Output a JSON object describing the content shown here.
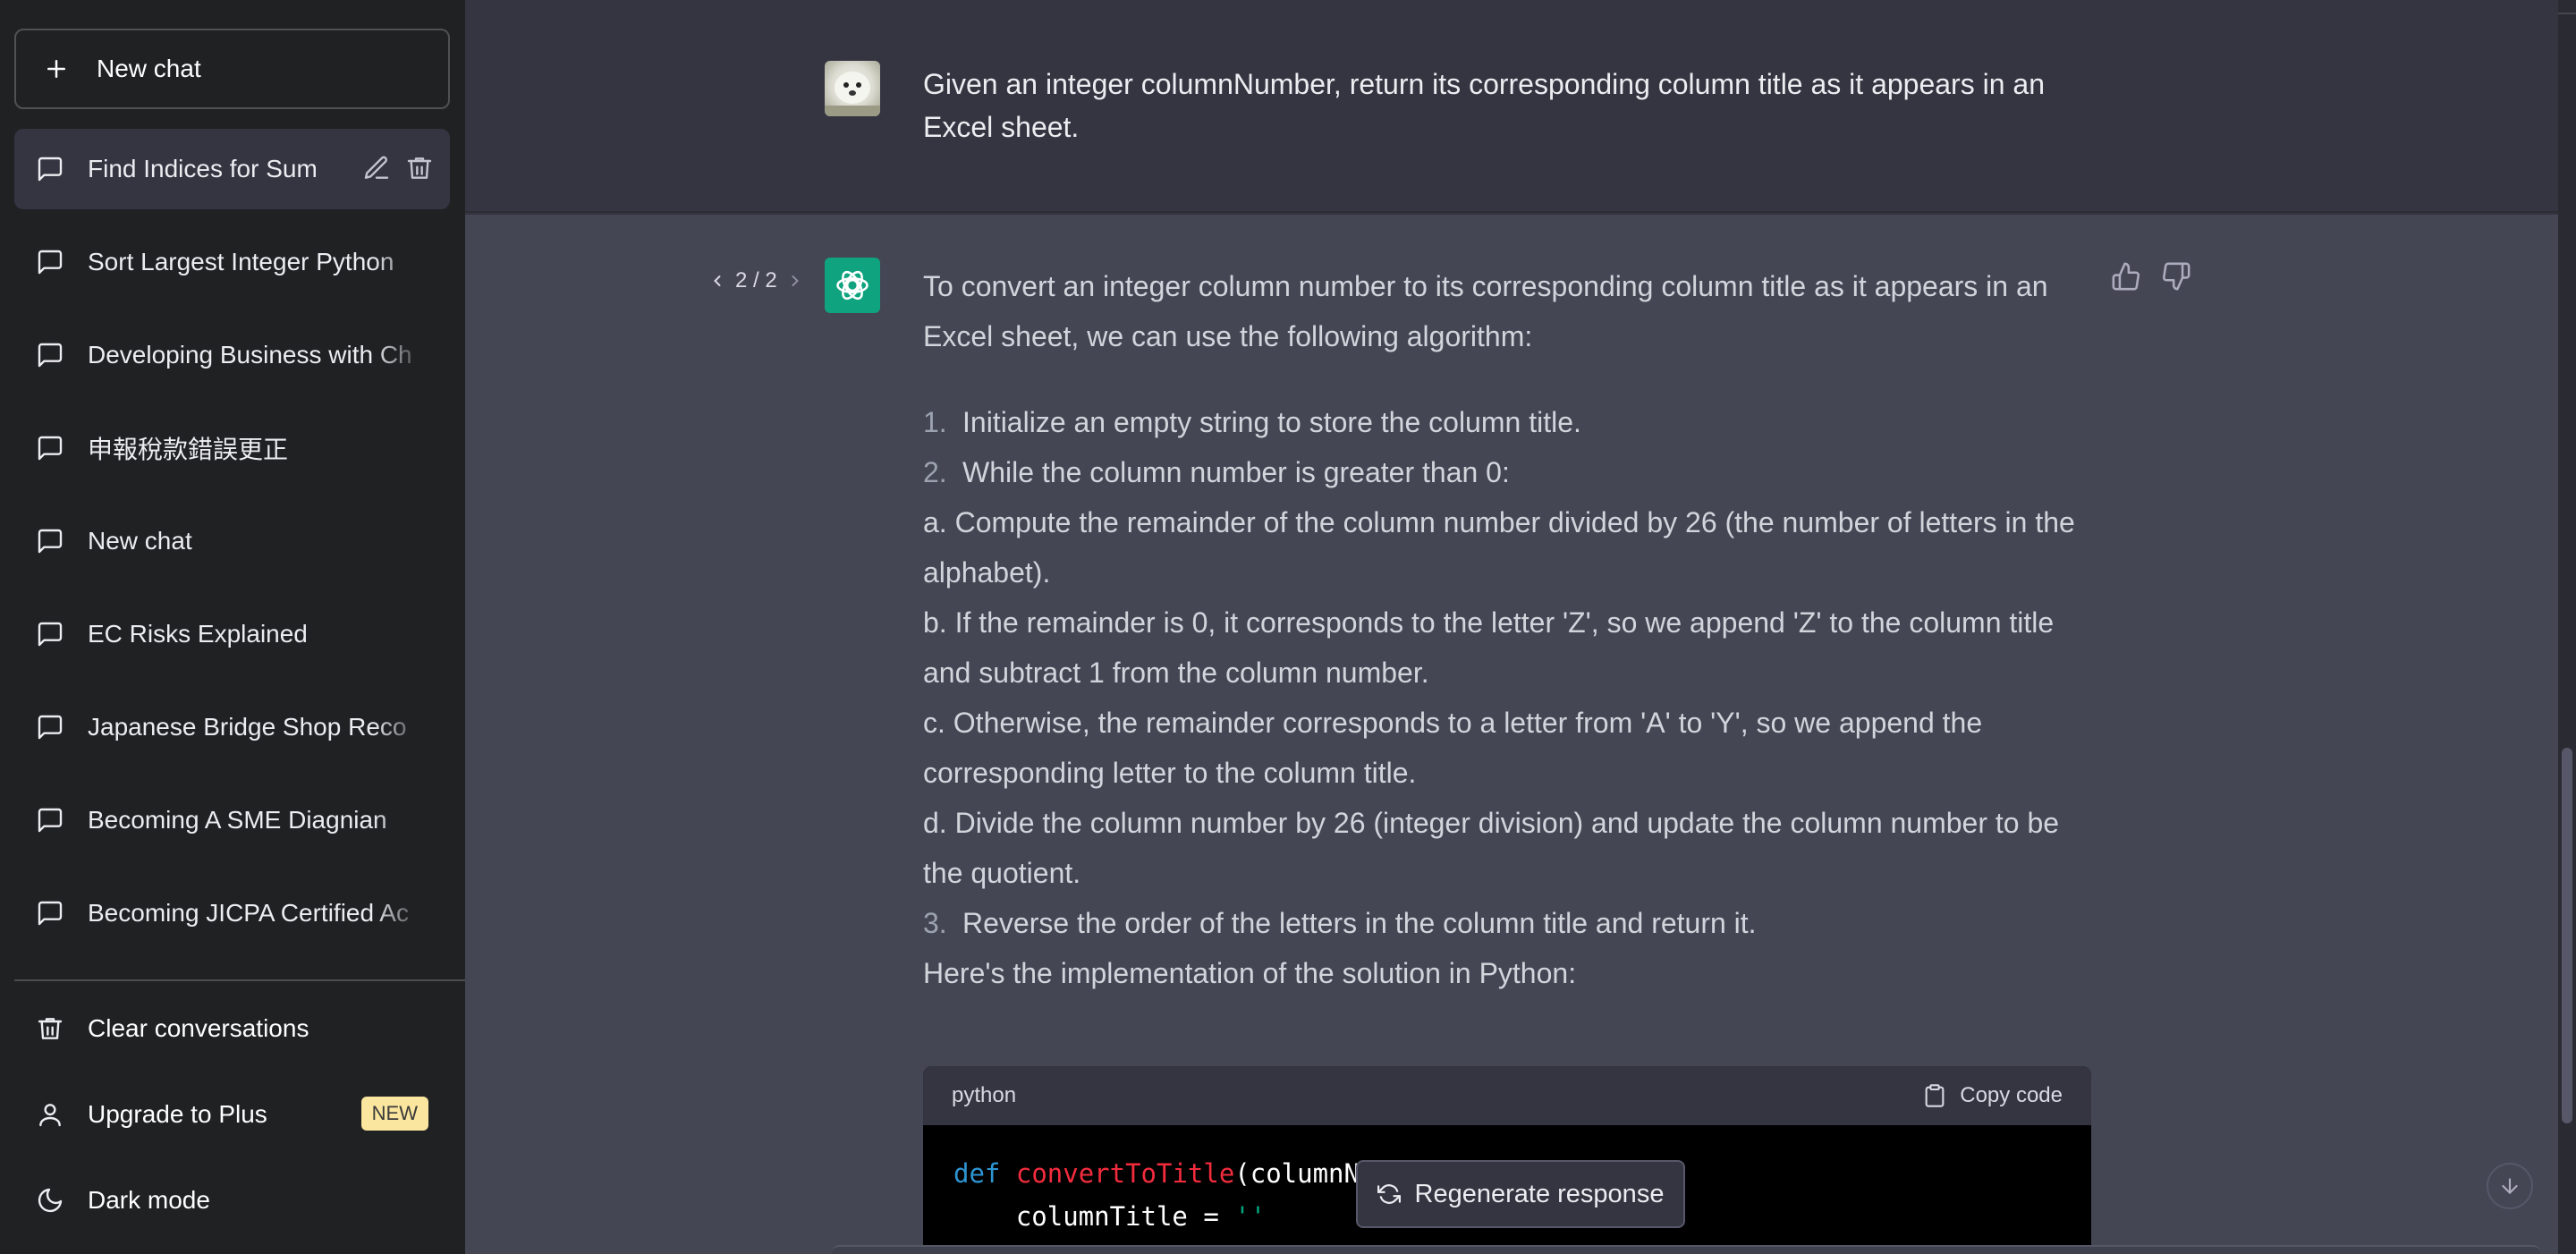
{
  "sidebar": {
    "new_chat_label": "New chat",
    "conversations": [
      {
        "label": "Find Indices for Sum"
      },
      {
        "label": "Sort Largest Integer Python"
      },
      {
        "label": "Developing Business with Ch"
      },
      {
        "label": "申報稅款錯誤更正"
      },
      {
        "label": "New chat"
      },
      {
        "label": "EC Risks Explained"
      },
      {
        "label": "Japanese Bridge Shop Reco"
      },
      {
        "label": "Becoming A SME Diagnian"
      },
      {
        "label": "Becoming JICPA Certified Ac"
      }
    ],
    "clear_label": "Clear conversations",
    "upgrade_label": "Upgrade to Plus",
    "upgrade_badge": "NEW",
    "dark_mode_label": "Dark mode"
  },
  "user_message": {
    "text": "Given an integer columnNumber, return its corresponding column title as it appears in an Excel sheet."
  },
  "assistant_message": {
    "pager": "2 / 2",
    "intro": "To convert an integer column number to its corresponding column title as it appears in an Excel sheet, we can use the following algorithm:",
    "steps": [
      {
        "num": "1.",
        "text": "Initialize an empty string to store the column title."
      },
      {
        "num": "2.",
        "text": "While the column number is greater than 0:"
      },
      {
        "num": "3.",
        "text": "Reverse the order of the letters in the column title and return it."
      }
    ],
    "substeps": [
      "a. Compute the remainder of the column number divided by 26 (the number of letters in the alphabet).",
      "b. If the remainder is 0, it corresponds to the letter 'Z', so we append 'Z' to the column title and subtract 1 from the column number.",
      "c. Otherwise, the remainder corresponds to a letter from 'A' to 'Y', so we append the corresponding letter to the column title.",
      "d. Divide the column number by 26 (integer division) and update the column number to be the quotient."
    ],
    "impl_text": "Here's the implementation of the solution in Python:"
  },
  "code": {
    "language": "python",
    "copy_label": "Copy code",
    "line1_kw": "def",
    "line1_fn": "convertToTitle",
    "line1_rest": "(columnNu",
    "line2_indent": "    columnTitle = ",
    "line2_str": "''"
  },
  "regenerate_label": "Regenerate response",
  "colors": {
    "sidebar_bg": "#202123",
    "main_bg": "#343541",
    "assistant_bg": "#444654",
    "gpt_avatar": "#10a37f",
    "new_badge": "#fae69e"
  }
}
